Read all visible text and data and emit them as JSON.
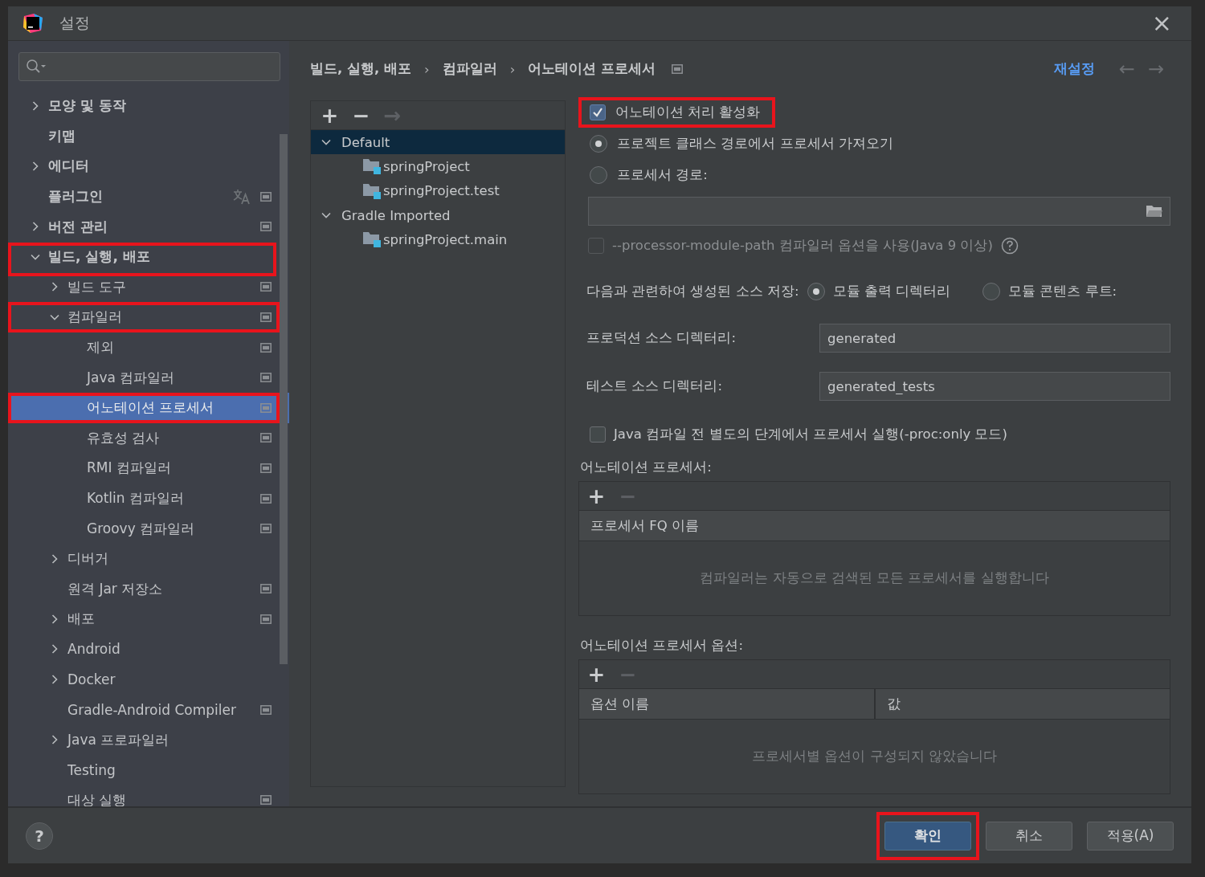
{
  "window": {
    "title": "설정",
    "close": "×"
  },
  "sidebar": {
    "items": [
      {
        "label": "모양 및 동작",
        "kind": "group",
        "expanded": false,
        "selected": false,
        "marked": false,
        "project_scope": false,
        "translatable": false
      },
      {
        "label": "키맵",
        "kind": "page",
        "selected": false,
        "marked": false,
        "project_scope": false,
        "translatable": false
      },
      {
        "label": "에디터",
        "kind": "group",
        "expanded": false,
        "selected": false,
        "marked": false,
        "project_scope": false,
        "translatable": false
      },
      {
        "label": "플러그인",
        "kind": "page",
        "selected": false,
        "marked": false,
        "project_scope": true,
        "translatable": true
      },
      {
        "label": "버전 관리",
        "kind": "group",
        "expanded": false,
        "selected": false,
        "marked": false,
        "project_scope": true,
        "translatable": false
      },
      {
        "label": "빌드, 실행, 배포",
        "kind": "group",
        "expanded": true,
        "selected": false,
        "marked": true,
        "project_scope": false,
        "translatable": false,
        "children": [
          {
            "label": "빌드 도구",
            "kind": "group",
            "expanded": false,
            "selected": false,
            "marked": false,
            "project_scope": true,
            "translatable": false
          },
          {
            "label": "컴파일러",
            "kind": "group",
            "expanded": true,
            "selected": false,
            "marked": true,
            "project_scope": true,
            "translatable": false,
            "children": [
              {
                "label": "제외",
                "kind": "page",
                "selected": false,
                "marked": false,
                "project_scope": true,
                "translatable": false
              },
              {
                "label": "Java 컴파일러",
                "kind": "page",
                "selected": false,
                "marked": false,
                "project_scope": true,
                "translatable": false
              },
              {
                "label": "어노테이션 프로세서",
                "kind": "page",
                "selected": true,
                "marked": true,
                "project_scope": true,
                "translatable": false
              },
              {
                "label": "유효성 검사",
                "kind": "page",
                "selected": false,
                "marked": false,
                "project_scope": true,
                "translatable": false
              },
              {
                "label": "RMI 컴파일러",
                "kind": "page",
                "selected": false,
                "marked": false,
                "project_scope": true,
                "translatable": false
              },
              {
                "label": "Kotlin 컴파일러",
                "kind": "page",
                "selected": false,
                "marked": false,
                "project_scope": true,
                "translatable": false
              },
              {
                "label": "Groovy 컴파일러",
                "kind": "page",
                "selected": false,
                "marked": false,
                "project_scope": true,
                "translatable": false
              }
            ]
          },
          {
            "label": "디버거",
            "kind": "group",
            "expanded": false,
            "selected": false,
            "marked": false,
            "project_scope": false,
            "translatable": false
          },
          {
            "label": "원격 Jar 저장소",
            "kind": "page",
            "selected": false,
            "marked": false,
            "project_scope": true,
            "translatable": false
          },
          {
            "label": "배포",
            "kind": "group",
            "expanded": false,
            "selected": false,
            "marked": false,
            "project_scope": true,
            "translatable": false
          },
          {
            "label": "Android",
            "kind": "group",
            "expanded": false,
            "selected": false,
            "marked": false,
            "project_scope": false,
            "translatable": false
          },
          {
            "label": "Docker",
            "kind": "group",
            "expanded": false,
            "selected": false,
            "marked": false,
            "project_scope": false,
            "translatable": false
          },
          {
            "label": "Gradle-Android Compiler",
            "kind": "page",
            "selected": false,
            "marked": false,
            "project_scope": true,
            "translatable": false
          },
          {
            "label": "Java 프로파일러",
            "kind": "group",
            "expanded": false,
            "selected": false,
            "marked": false,
            "project_scope": false,
            "translatable": false
          },
          {
            "label": "Testing",
            "kind": "page",
            "selected": false,
            "marked": false,
            "project_scope": false,
            "translatable": false
          },
          {
            "label": "대상 실행",
            "kind": "page",
            "selected": false,
            "marked": false,
            "project_scope": true,
            "translatable": false
          }
        ]
      }
    ]
  },
  "breadcrumb": [
    "빌드, 실행, 배포",
    "컴파일러",
    "어노테이션 프로세서"
  ],
  "breadcrumb_separator": "›",
  "reset_link": "재설정",
  "nav": [
    {
      "symbol": "←",
      "disabled": true
    },
    {
      "symbol": "→",
      "disabled": true
    }
  ],
  "profiles": {
    "toolbar": [
      {
        "symbol": "+",
        "disabled": false
      },
      {
        "symbol": "−",
        "disabled": false
      },
      {
        "symbol": "→",
        "disabled": true
      }
    ],
    "items": [
      {
        "label": "Default",
        "expanded": true,
        "selected": true,
        "children": [
          {
            "label": "springProject",
            "selected": false
          },
          {
            "label": "springProject.test",
            "selected": false
          }
        ]
      },
      {
        "label": "Gradle Imported",
        "expanded": true,
        "selected": false,
        "children": [
          {
            "label": "springProject.main",
            "selected": false
          }
        ]
      }
    ]
  },
  "enable_processing": {
    "label": "어노테이션 처리 활성화",
    "checked": true,
    "marked": true
  },
  "source_options": [
    {
      "label": "프로젝트 클래스 경로에서 프로세서 가져오기",
      "selected": true
    },
    {
      "label": "프로세서 경로:",
      "selected": false
    }
  ],
  "module_path_option": {
    "label": "--processor-module-path 컴파일러 옵션을 사용(Java 9 이상)",
    "checked": false,
    "disabled": true
  },
  "store_sources": {
    "label": "다음과 관련하여 생성된 소스 저장:",
    "options": [
      {
        "label": "모듈 출력 디렉터리",
        "selected": true
      },
      {
        "label": "모듈 콘텐츠 루트:",
        "selected": false
      }
    ]
  },
  "directories": [
    {
      "label": "프로덕션 소스 디렉터리:",
      "value": "generated"
    },
    {
      "label": "테스트 소스 디렉터리:",
      "value": "generated_tests"
    }
  ],
  "proc_only_option": {
    "label": "Java 컴파일 전 별도의 단계에서 프로세서 실행(-proc:only 모드)",
    "checked": false,
    "disabled": false
  },
  "tables": [
    {
      "title": "어노테이션 프로세서:",
      "toolbar": [
        {
          "symbol": "+",
          "disabled": false
        },
        {
          "symbol": "−",
          "disabled": true
        }
      ],
      "columns": [
        "프로세서 FQ 이름"
      ],
      "empty_text": "컴파일러는 자동으로 검색된 모든 프로세서를 실행합니다"
    },
    {
      "title": "어노테이션 프로세서 옵션:",
      "toolbar": [
        {
          "symbol": "+",
          "disabled": false
        },
        {
          "symbol": "−",
          "disabled": true
        }
      ],
      "columns": [
        "옵션 이름",
        "값"
      ],
      "empty_text": "프로세서별 옵션이 구성되지 않았습니다"
    }
  ],
  "footer": {
    "help": "?",
    "buttons": [
      {
        "label": "확인",
        "default": true,
        "marked": true
      },
      {
        "label": "취소",
        "default": false,
        "marked": false
      },
      {
        "label": "적용(A)",
        "default": false,
        "marked": false
      }
    ]
  }
}
